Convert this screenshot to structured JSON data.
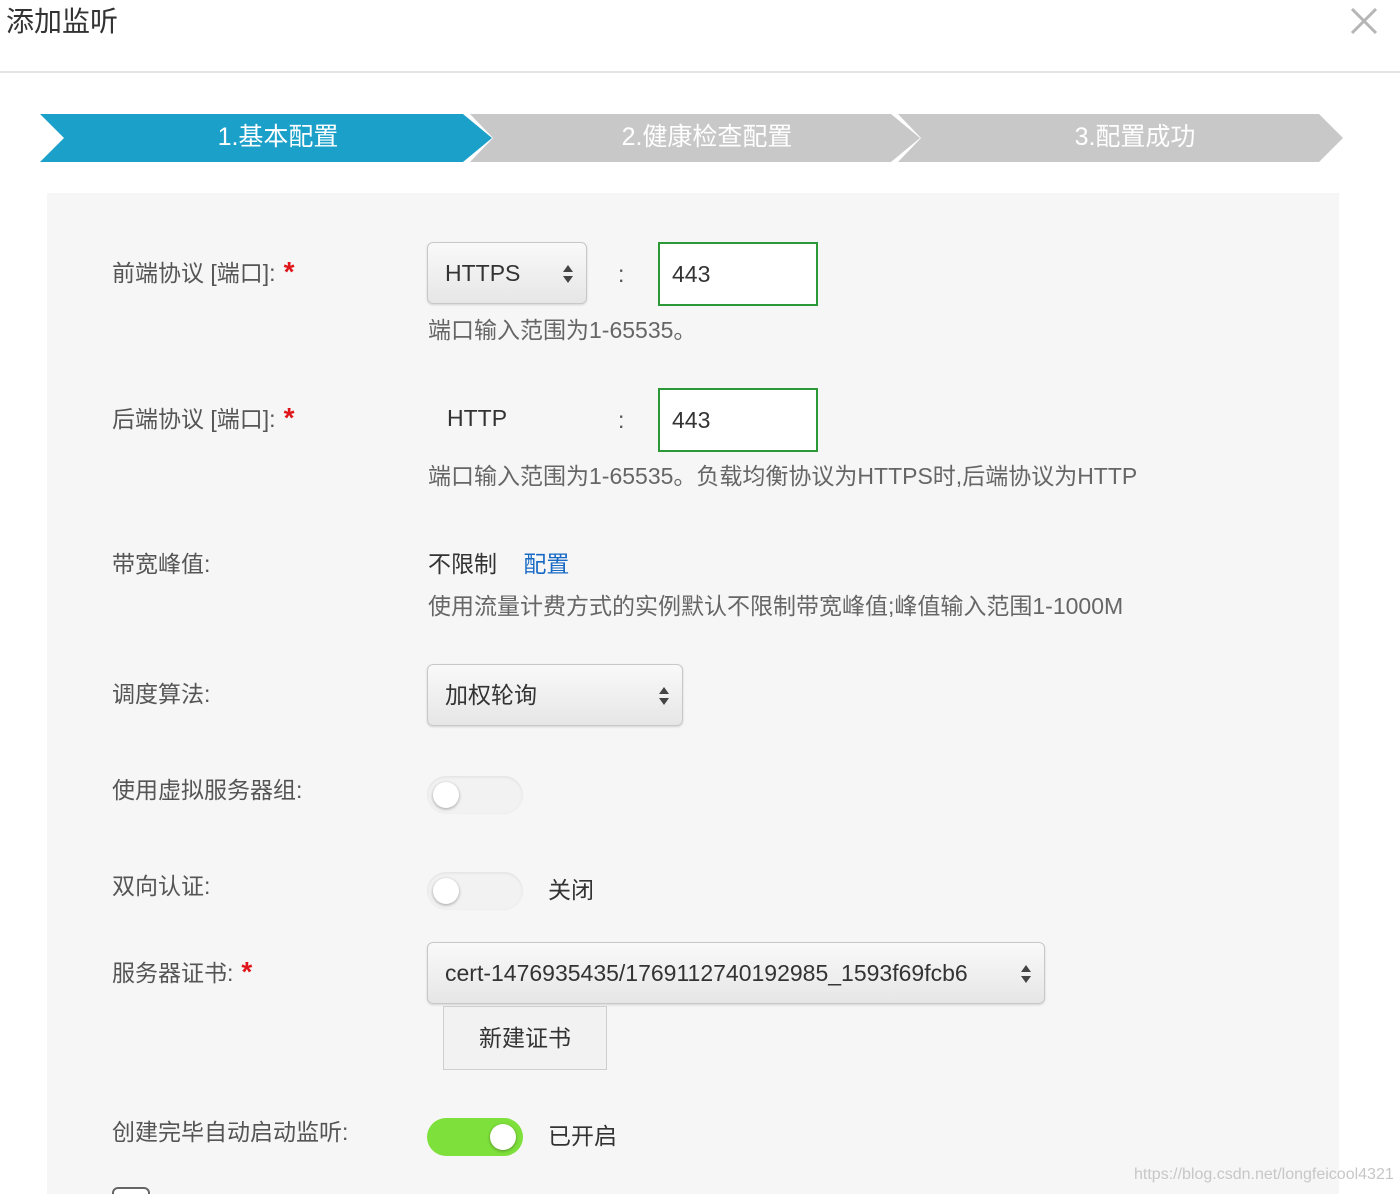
{
  "dialog": {
    "title": "添加监听",
    "close_icon": "close-icon"
  },
  "steps": [
    {
      "label": "1.基本配置",
      "state": "active",
      "color": "#1aa0c9"
    },
    {
      "label": "2.健康检查配置",
      "state": "inactive",
      "color": "#c8c8c8"
    },
    {
      "label": "3.配置成功",
      "state": "inactive",
      "color": "#c8c8c8"
    }
  ],
  "form": {
    "frontend": {
      "label": "前端协议 [端口]:",
      "required_mark": "*",
      "protocol": "HTTPS",
      "separator": ":",
      "port": "443",
      "hint": "端口输入范围为1-65535。"
    },
    "backend": {
      "label": "后端协议 [端口]:",
      "required_mark": "*",
      "protocol": "HTTP",
      "separator": ":",
      "port": "443",
      "hint": "端口输入范围为1-65535。负载均衡协议为HTTPS时,后端协议为HTTP"
    },
    "bandwidth": {
      "label": "带宽峰值:",
      "value": "不限制",
      "config_link": "配置",
      "hint": "使用流量计费方式的实例默认不限制带宽峰值;峰值输入范围1-1000M"
    },
    "scheduler": {
      "label": "调度算法:",
      "value": "加权轮询"
    },
    "vserver_group": {
      "label": "使用虚拟服务器组:",
      "enabled": false
    },
    "mutual_auth": {
      "label": "双向认证:",
      "enabled": false,
      "status": "关闭"
    },
    "server_cert": {
      "label": "服务器证书:",
      "required_mark": "*",
      "value": "cert-1476935435/1769112740192985_1593f69fcb6",
      "new_button": "新建证书"
    },
    "auto_start": {
      "label": "创建完毕自动启动监听:",
      "enabled": true,
      "status": "已开启"
    }
  },
  "colors": {
    "accent": "#1aa0c9",
    "required": "#e0151b",
    "input_border": "#2b9a36",
    "toggle_on": "#7ee03b",
    "link": "#1769c4"
  },
  "watermark": "https://blog.csdn.net/longfeicool4321"
}
